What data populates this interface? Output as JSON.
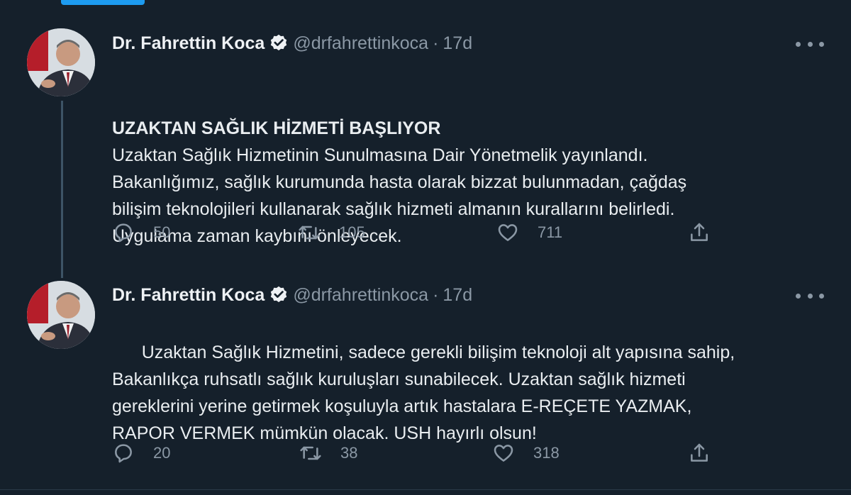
{
  "tweets": [
    {
      "author_name": "Dr. Fahrettin Koca",
      "handle": "@drfahrettinkoca",
      "separator": "·",
      "time": "17d",
      "title": "UZAKTAN SAĞLIK HİZMETİ BAŞLIYOR",
      "text": "Uzaktan Sağlık Hizmetinin Sunulmasına Dair Yönetmelik yayınlandı.\nBakanlığımız, sağlık kurumunda hasta olarak bizzat bulunmadan, çağdaş\nbilişim teknolojileri kullanarak sağlık hizmeti almanın kurallarını belirledi.\nUygulama zaman kaybını önleyecek.",
      "replies": "50",
      "retweets": "105",
      "likes": "711"
    },
    {
      "author_name": "Dr. Fahrettin Koca",
      "handle": "@drfahrettinkoca",
      "separator": "·",
      "time": "17d",
      "title": "",
      "text": "Uzaktan Sağlık Hizmetini, sadece gerekli bilişim teknoloji alt yapısına sahip,\nBakanlıkça ruhsatlı sağlık kuruluşları sunabilecek. Uzaktan sağlık hizmeti\ngereklerini yerine getirmek koşuluyla artık hastalara E-REÇETE YAZMAK,\nRAPOR VERMEK mümkün olacak. USH hayırlı olsun!",
      "replies": "20",
      "retweets": "38",
      "likes": "318"
    }
  ],
  "icons": {
    "verified": "verified-badge-icon",
    "reply": "reply-icon",
    "retweet": "retweet-icon",
    "like": "heart-icon",
    "share": "share-icon",
    "more": "more-icon"
  },
  "colors": {
    "background": "#15202b",
    "accent": "#1d9bf0",
    "muted": "#8b98a5",
    "text": "#e9edf0"
  }
}
